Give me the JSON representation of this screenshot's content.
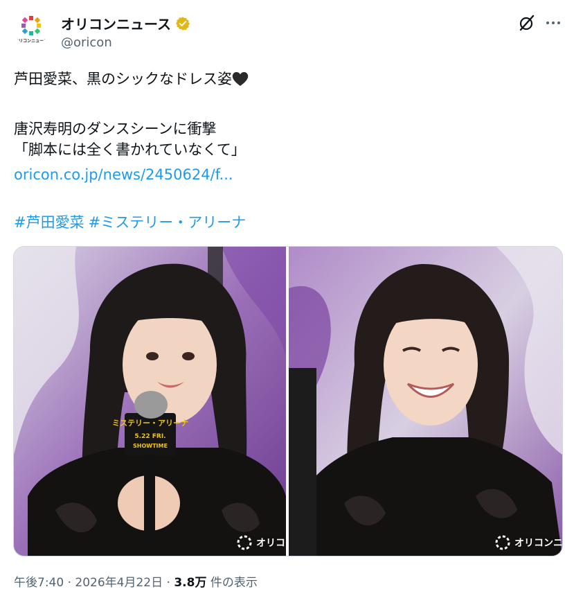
{
  "account": {
    "display_name": "オリコンニュース",
    "handle": "@oricon",
    "avatar_caption": "オリコンニュース",
    "verified_color": "#e2b719"
  },
  "tweet": {
    "line1": "芦田愛菜、黒のシックなドレス姿",
    "line2": "唐沢寿明のダンスシーンに衝撃",
    "line3": "「脚本には全く書かれていなくて」",
    "link": "oricon.co.jp/news/2450624/f...",
    "hashtags": [
      "#芦田愛菜",
      "#ミステリー・アリーナ"
    ]
  },
  "media": {
    "left_watermark": "オリコ",
    "right_watermark": "オリコンニュー",
    "mic_flag_title": "ミステリー・アリーナ",
    "mic_flag_date": "5.22 FRI.",
    "mic_flag_sub": "SHOWTIME"
  },
  "meta": {
    "time": "午後7:40",
    "separator": "·",
    "date": "2026年4月22日",
    "views_count": "3.8万",
    "views_label": "件の表示"
  },
  "colors": {
    "link": "#1d9bf0",
    "text": "#0f1419",
    "secondary": "#536471"
  },
  "icons": [
    "verified-badge-icon",
    "grok-icon",
    "more-icon",
    "black-heart-icon",
    "oricon-logo-icon"
  ]
}
